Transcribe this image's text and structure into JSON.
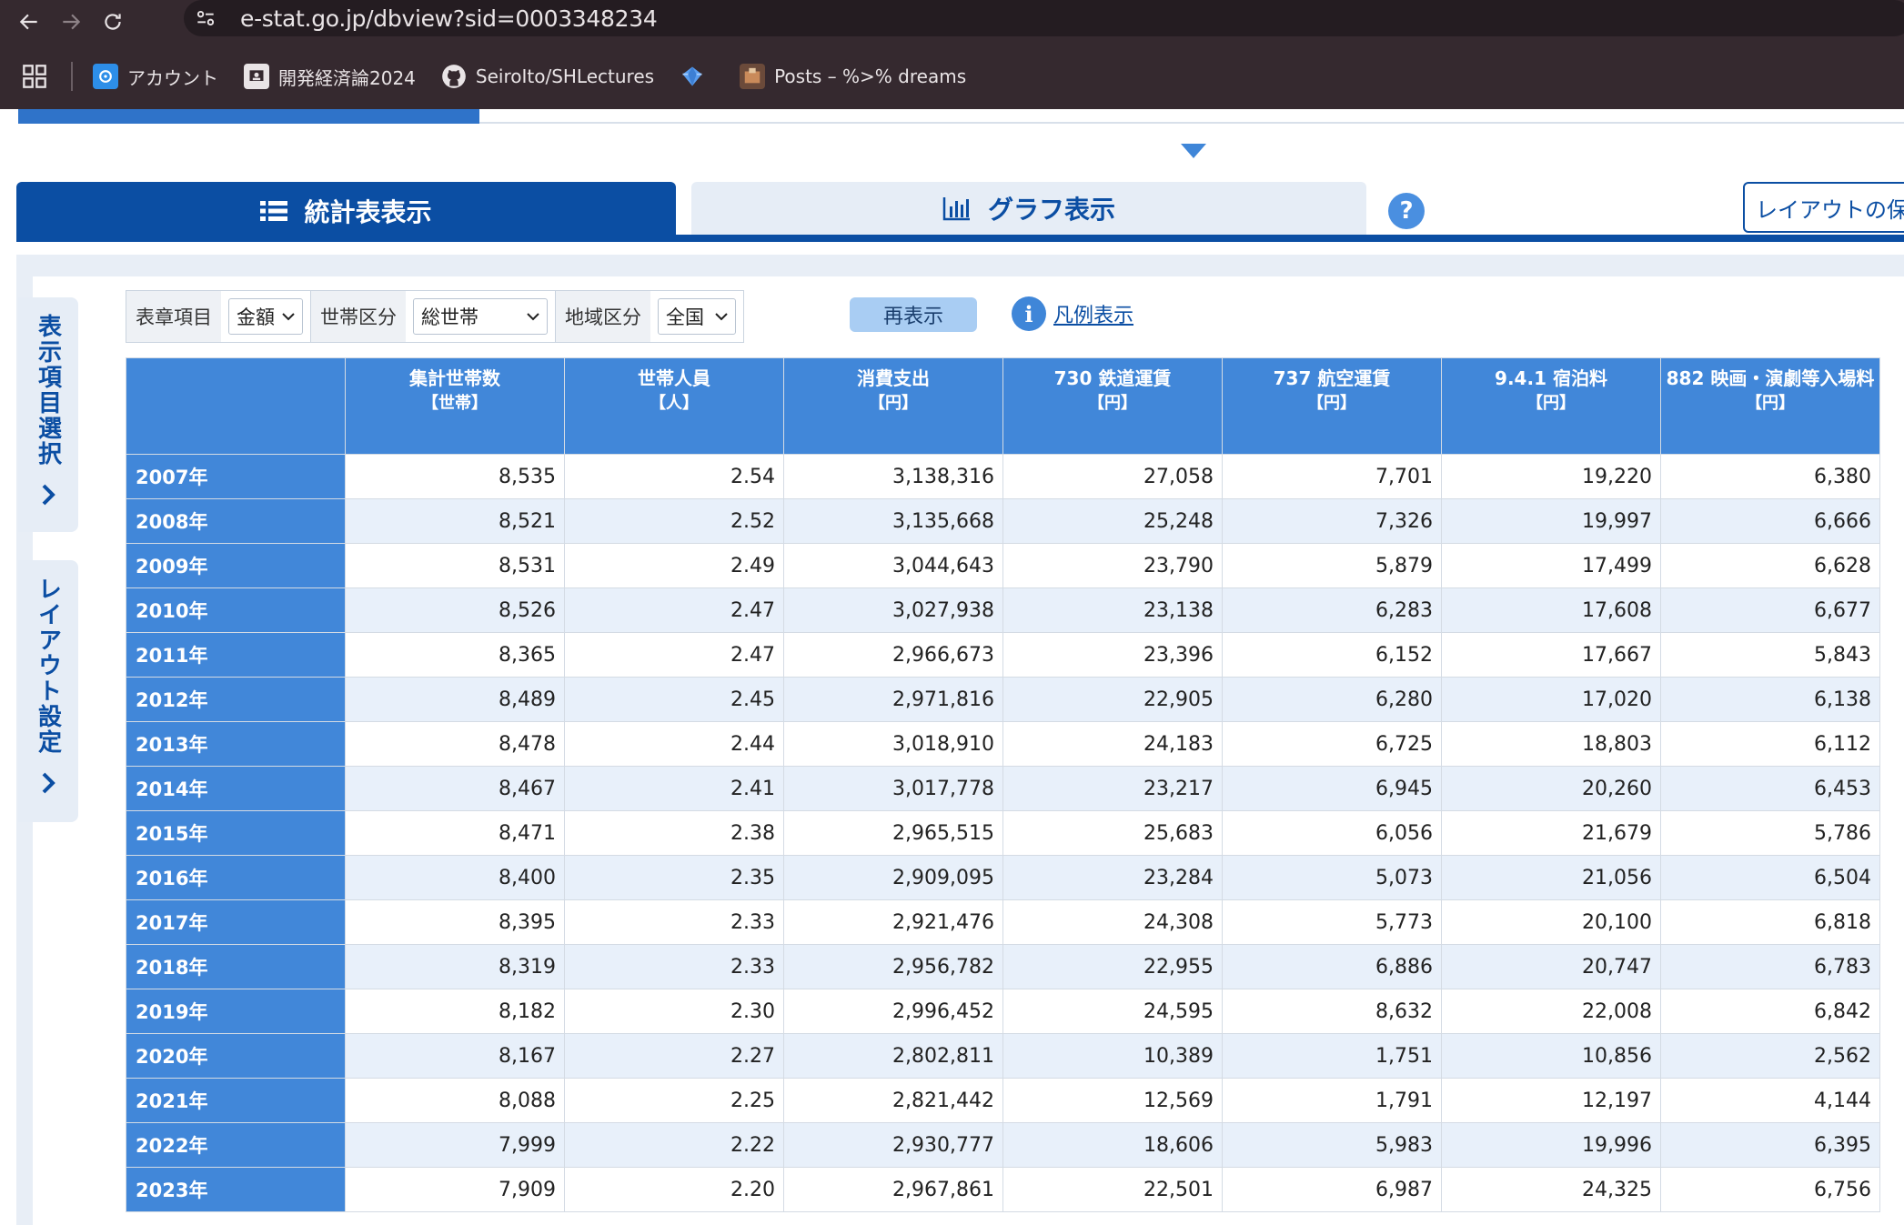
{
  "browser": {
    "url": "e-stat.go.jp/dbview?sid=0003348234",
    "bookmarks": [
      {
        "label": "アカウント",
        "icon": "account-cloud-icon"
      },
      {
        "label": "開発経済論2024",
        "icon": "classroom-icon"
      },
      {
        "label": "SeiroIto/SHLectures",
        "icon": "github-icon"
      },
      {
        "label": "",
        "icon": "gem-icon"
      },
      {
        "label": "Posts – %>% dreams",
        "icon": "blog-icon"
      }
    ]
  },
  "tabs": {
    "table_view": "統計表表示",
    "graph_view": "グラフ表示",
    "help": "?",
    "layout_save": "レイアウトの保"
  },
  "side": {
    "item_select": "表示項目選択",
    "layout_settings": "レイアウト設定"
  },
  "filters": [
    {
      "label": "表章項目",
      "value": "金額"
    },
    {
      "label": "世帯区分",
      "value": "総世帯"
    },
    {
      "label": "地域区分",
      "value": "全国"
    }
  ],
  "redisplay_label": "再表示",
  "legend_label": "凡例表示",
  "table": {
    "columns": [
      {
        "name": "集計世帯数",
        "unit": "【世帯】"
      },
      {
        "name": "世帯人員",
        "unit": "【人】"
      },
      {
        "name": "消費支出",
        "unit": "【円】"
      },
      {
        "name": "730 鉄道運賃",
        "unit": "【円】"
      },
      {
        "name": "737 航空運賃",
        "unit": "【円】"
      },
      {
        "name": "9.4.1 宿泊料",
        "unit": "【円】"
      },
      {
        "name": "882 映画・演劇等入場料",
        "unit": "【円】"
      }
    ],
    "rows": [
      {
        "year": "2007年",
        "values": [
          "8,535",
          "2.54",
          "3,138,316",
          "27,058",
          "7,701",
          "19,220",
          "6,380"
        ]
      },
      {
        "year": "2008年",
        "values": [
          "8,521",
          "2.52",
          "3,135,668",
          "25,248",
          "7,326",
          "19,997",
          "6,666"
        ]
      },
      {
        "year": "2009年",
        "values": [
          "8,531",
          "2.49",
          "3,044,643",
          "23,790",
          "5,879",
          "17,499",
          "6,628"
        ]
      },
      {
        "year": "2010年",
        "values": [
          "8,526",
          "2.47",
          "3,027,938",
          "23,138",
          "6,283",
          "17,608",
          "6,677"
        ]
      },
      {
        "year": "2011年",
        "values": [
          "8,365",
          "2.47",
          "2,966,673",
          "23,396",
          "6,152",
          "17,667",
          "5,843"
        ]
      },
      {
        "year": "2012年",
        "values": [
          "8,489",
          "2.45",
          "2,971,816",
          "22,905",
          "6,280",
          "17,020",
          "6,138"
        ]
      },
      {
        "year": "2013年",
        "values": [
          "8,478",
          "2.44",
          "3,018,910",
          "24,183",
          "6,725",
          "18,803",
          "6,112"
        ]
      },
      {
        "year": "2014年",
        "values": [
          "8,467",
          "2.41",
          "3,017,778",
          "23,217",
          "6,945",
          "20,260",
          "6,453"
        ]
      },
      {
        "year": "2015年",
        "values": [
          "8,471",
          "2.38",
          "2,965,515",
          "25,683",
          "6,056",
          "21,679",
          "5,786"
        ]
      },
      {
        "year": "2016年",
        "values": [
          "8,400",
          "2.35",
          "2,909,095",
          "23,284",
          "5,073",
          "21,056",
          "6,504"
        ]
      },
      {
        "year": "2017年",
        "values": [
          "8,395",
          "2.33",
          "2,921,476",
          "24,308",
          "5,773",
          "20,100",
          "6,818"
        ]
      },
      {
        "year": "2018年",
        "values": [
          "8,319",
          "2.33",
          "2,956,782",
          "22,955",
          "6,886",
          "20,747",
          "6,783"
        ]
      },
      {
        "year": "2019年",
        "values": [
          "8,182",
          "2.30",
          "2,996,452",
          "24,595",
          "8,632",
          "22,008",
          "6,842"
        ]
      },
      {
        "year": "2020年",
        "values": [
          "8,167",
          "2.27",
          "2,802,811",
          "10,389",
          "1,751",
          "10,856",
          "2,562"
        ]
      },
      {
        "year": "2021年",
        "values": [
          "8,088",
          "2.25",
          "2,821,442",
          "12,569",
          "1,791",
          "12,197",
          "4,144"
        ]
      },
      {
        "year": "2022年",
        "values": [
          "7,999",
          "2.22",
          "2,930,777",
          "18,606",
          "5,983",
          "19,996",
          "6,395"
        ]
      },
      {
        "year": "2023年",
        "values": [
          "7,909",
          "2.20",
          "2,967,861",
          "22,501",
          "6,987",
          "24,325",
          "6,756"
        ]
      }
    ]
  }
}
